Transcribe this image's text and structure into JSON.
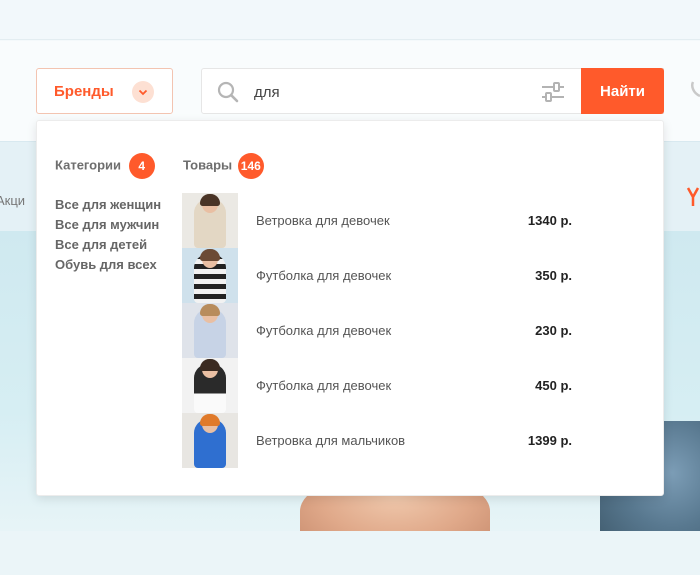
{
  "brand_button": {
    "label": "Бренды"
  },
  "search": {
    "value": "для"
  },
  "search_button": {
    "label": "Найти"
  },
  "nav": {
    "left_text": "Акци"
  },
  "dropdown": {
    "categories_title": "Категории",
    "categories_count": "4",
    "categories": [
      {
        "label": "Все для женщин"
      },
      {
        "label": "Все для мужчин"
      },
      {
        "label": "Все для детей"
      },
      {
        "label": "Обувь для всех"
      }
    ],
    "products_title": "Товары",
    "products_count": "146",
    "products": [
      {
        "name": "Ветровка для девочек",
        "price": "1340 р.",
        "image": "girl-windbreaker-photo"
      },
      {
        "name": "Футболка для девочек",
        "price": "350 р.",
        "image": "girl-striped-tshirt-photo"
      },
      {
        "name": "Футболка для девочек",
        "price": "230 р.",
        "image": "girl-tshirt-photo"
      },
      {
        "name": "Футболка для девочек",
        "price": "450 р.",
        "image": "girl-tshirt-photo"
      },
      {
        "name": "Ветровка для мальчиков",
        "price": "1399 р.",
        "image": "boy-windbreaker-photo"
      }
    ]
  },
  "colors": {
    "accent": "#ff5a2b",
    "accent_light": "#fde0d3",
    "text_muted": "#666666"
  },
  "icons": {
    "search": "search-icon",
    "filter": "filter-sliders-icon",
    "chevron": "chevron-down-icon"
  }
}
